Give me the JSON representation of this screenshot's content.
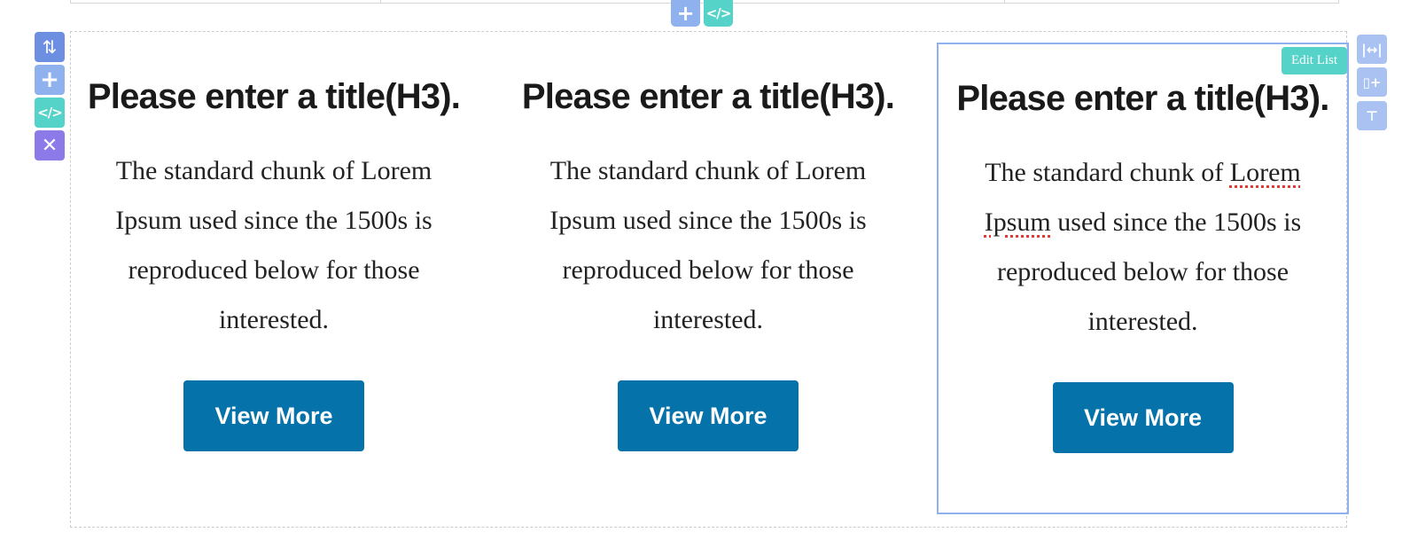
{
  "toolbar": {
    "top": {
      "add_icon": "plus-icon",
      "add_label": "+",
      "code_icon": "code-icon",
      "code_label": "</>"
    },
    "left": {
      "move_label": "⇅",
      "add_label": "+",
      "code_label": "</>",
      "delete_label": "✕"
    },
    "right": {
      "width_label": "|↔|",
      "add_column_label": "▯+",
      "add_row_label": "⊤"
    },
    "edit_list_label": "Edit List"
  },
  "columns": [
    {
      "title": "Please enter a title(H3).",
      "text_before": "The standard chunk of Lorem Ipsum used since the 1500s is reproduced below for those interested.",
      "button_label": "View More"
    },
    {
      "title": "Please enter a title(H3).",
      "text_before": "The standard chunk of Lorem Ipsum used since the 1500s is reproduced below for those interested.",
      "button_label": "View More"
    },
    {
      "title": "Please enter a title(H3).",
      "text_part1": "The standard chunk of ",
      "text_spell1": "Lorem",
      "text_part2": " ",
      "text_spell2": "Ipsum",
      "text_part3": " used since the 1500s is reproduced below for those interested.",
      "button_label": "View More"
    }
  ],
  "colors": {
    "button_bg": "#0573aa",
    "accent_teal": "#56d3c9",
    "accent_blue": "#8fb2ee",
    "accent_purple": "#8c7ae8"
  }
}
